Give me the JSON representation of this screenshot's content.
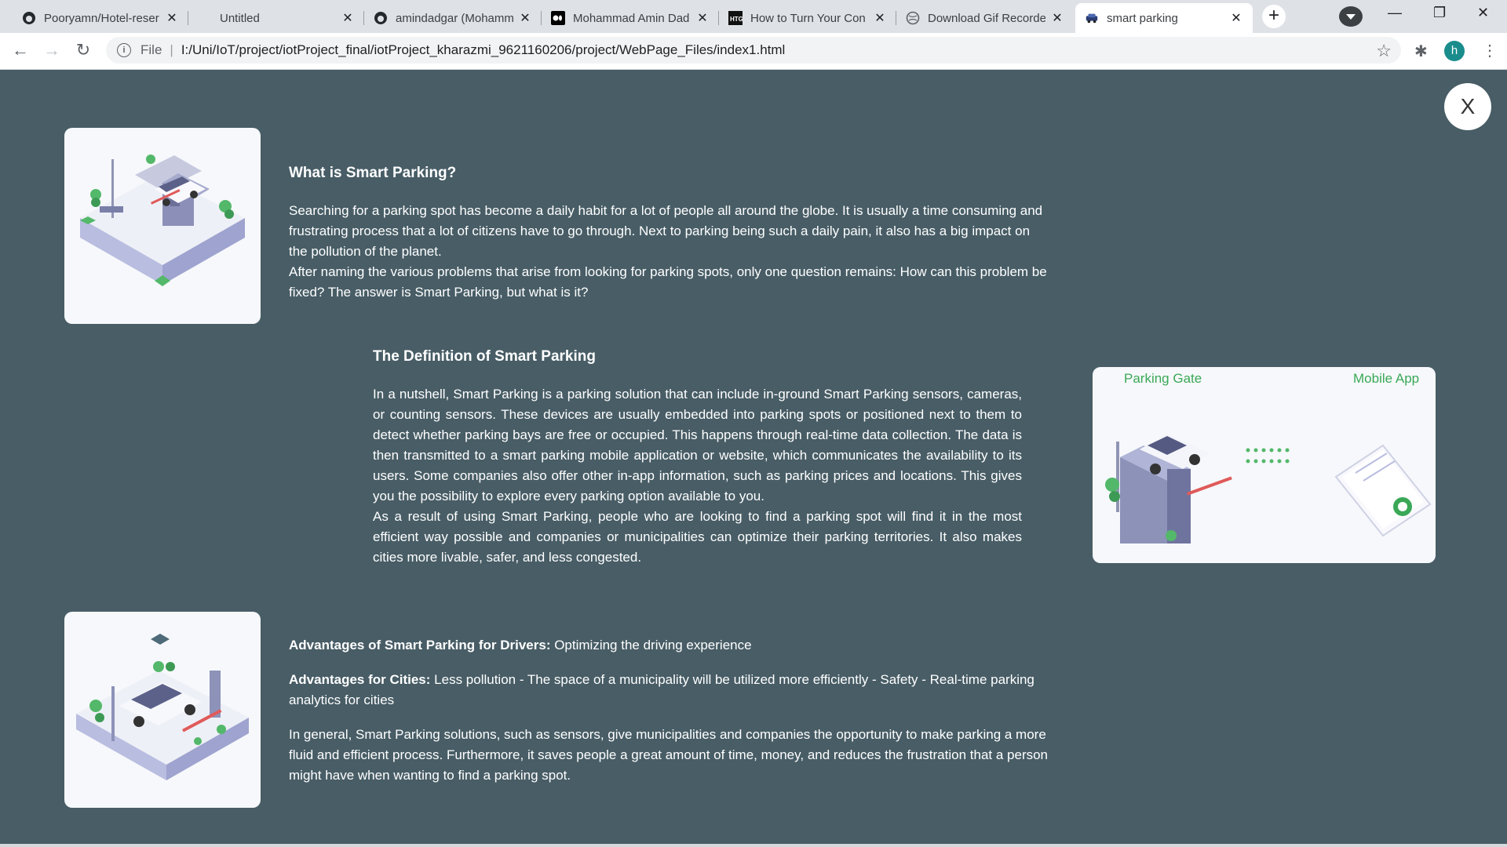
{
  "browser": {
    "tabs": [
      {
        "title": "Pooryamn/Hotel-reser",
        "favicon": "github-icon"
      },
      {
        "title": "Untitled",
        "favicon": "none"
      },
      {
        "title": "amindadgar (Mohamm",
        "favicon": "github-icon"
      },
      {
        "title": "Mohammad Amin Dad",
        "favicon": "medium-icon"
      },
      {
        "title": "How to Turn Your Con",
        "favicon": "htg-icon"
      },
      {
        "title": "Download Gif Recorde",
        "favicon": "globe-icon"
      },
      {
        "title": "smart parking",
        "favicon": "car-icon",
        "active": true
      }
    ],
    "address": {
      "scheme": "File",
      "url": "I:/Uni/IoT/project/iotProject_final/iotProject_kharazmi_9621160206/project/WebPage_Files/index1.html"
    },
    "profile_initial": "h"
  },
  "page": {
    "close_label": "X",
    "section1": {
      "title": "What is Smart Parking?",
      "p1": "Searching for a parking spot has become a daily habit for a lot of people all around the globe. It is usually a time consuming and frustrating process that a lot of citizens have to go through. Next to parking being such a daily pain, it also has a big impact on the pollution of the planet.",
      "p2": "After naming the various problems that arise from looking for parking spots, only one question remains: How can this problem be fixed? The answer is Smart Parking, but what is it?"
    },
    "section2": {
      "title": "The Definition of Smart Parking",
      "p1": "In a nutshell, Smart Parking is a parking solution that can include in-ground Smart Parking sensors, cameras, or counting sensors. These devices are usually embedded into parking spots or positioned next to them to detect whether parking bays are free or occupied. This happens through real-time data collection. The data is then transmitted to a smart parking mobile application or website, which communicates the availability to its users. Some companies also offer other in-app information, such as parking prices and locations. This gives you the possibility to explore every parking option available to you.",
      "p2": "As a result of using Smart Parking, people who are looking to find a parking spot will find it in the most efficient way possible and companies or municipalities can optimize their parking territories. It also makes cities more livable, safer, and less congested.",
      "image_labels": {
        "left": "Parking Gate",
        "right": "Mobile App"
      }
    },
    "section3": {
      "drivers_lead": "Advantages of Smart Parking for Drivers:",
      "drivers_text": " Optimizing the driving experience",
      "cities_lead": "Advantages for Cities:",
      "cities_text": " Less pollution - The space of a municipality will be utilized more efficiently - Safety - Real-time parking analytics for cities",
      "summary": "In general, Smart Parking solutions, such as sensors, give municipalities and companies the opportunity to make parking a more fluid and efficient process. Furthermore, it saves people a great amount of time, money, and reduces the frustration that a person might have when wanting to find a parking spot."
    }
  }
}
